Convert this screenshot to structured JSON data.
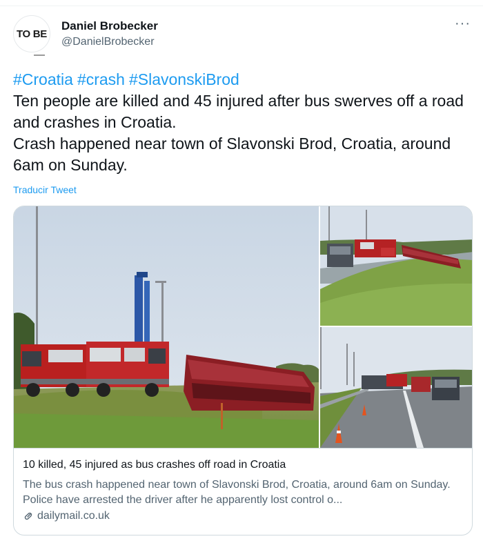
{
  "author": {
    "avatar_text": "TO BE",
    "display_name": "Daniel Brobecker",
    "handle": "@DanielBrobecker"
  },
  "more_label": "···",
  "tweet": {
    "hashtags": [
      "#Croatia",
      "#crash",
      "#SlavonskiBrod"
    ],
    "line1": "Ten people are killed and 45 injured after bus swerves off a road and crashes in Croatia.",
    "line2": "Crash happened near town of Slavonski Brod, Croatia, around 6am on Sunday."
  },
  "translate_label": "Traducir Tweet",
  "link_card": {
    "title": "10 killed, 45 injured as bus crashes off road in Croatia",
    "description": "The bus crash happened near town of Slavonski Brod, Croatia, around 6am on Sunday. Police have arrested the driver after he apparently lost control o...",
    "domain": "dailymail.co.uk"
  },
  "colors": {
    "link_blue": "#1d9bf0",
    "secondary_text": "#536471",
    "border": "#cfd9de"
  },
  "icons": {
    "more": "more-icon",
    "link": "link-icon"
  }
}
